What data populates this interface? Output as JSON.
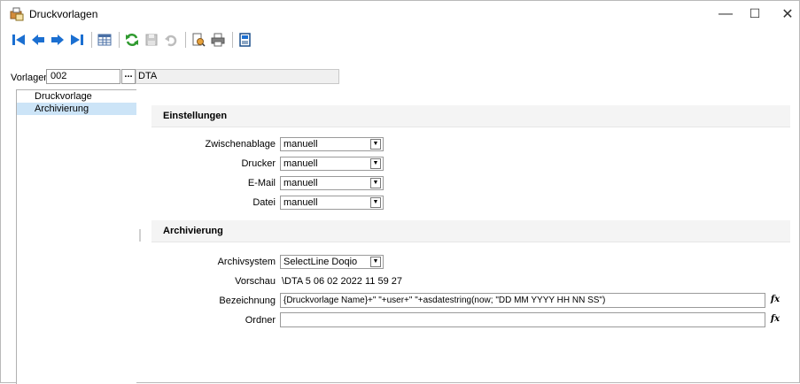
{
  "window": {
    "title": "Druckvorlagen",
    "controls": {
      "minimize": "—",
      "maximize": "☐",
      "close": "✕"
    }
  },
  "toolbar": {
    "buttons": [
      "first-record",
      "previous-record",
      "next-record",
      "last-record",
      "table-view",
      "refresh",
      "save",
      "undo",
      "print-preview",
      "print",
      "export"
    ]
  },
  "header": {
    "vorlagenart_label": "Vorlagenart",
    "vorlagenart_value": "002",
    "lookup_label": "...",
    "vorlagenart_name": "DTA"
  },
  "nav": {
    "items": [
      {
        "label": "Druckvorlage",
        "selected": false
      },
      {
        "label": "Archivierung",
        "selected": true
      }
    ]
  },
  "einstellungen": {
    "title": "Einstellungen",
    "fields": [
      {
        "label": "Zwischenablage",
        "value": "manuell"
      },
      {
        "label": "Drucker",
        "value": "manuell"
      },
      {
        "label": "E-Mail",
        "value": "manuell"
      },
      {
        "label": "Datei",
        "value": "manuell"
      }
    ]
  },
  "archivierung": {
    "title": "Archivierung",
    "archivsystem_label": "Archivsystem",
    "archivsystem_value": "SelectLine Doqio",
    "vorschau_label": "Vorschau",
    "vorschau_value": "\\DTA  5 06 02 2022 11 59 27",
    "bezeichnung_label": "Bezeichnung",
    "bezeichnung_value": "{Druckvorlage Name}+\" \"+user+\" \"+asdatestring(now; \"DD MM YYYY HH NN SS\")",
    "ordner_label": "Ordner",
    "ordner_value": "",
    "fx_label": "fx"
  },
  "colors": {
    "selection": "#cce4f7",
    "section_bg": "#f4f4f4",
    "nav_blue": "#1b6fd1",
    "refresh_green": "#2f9a2f"
  }
}
